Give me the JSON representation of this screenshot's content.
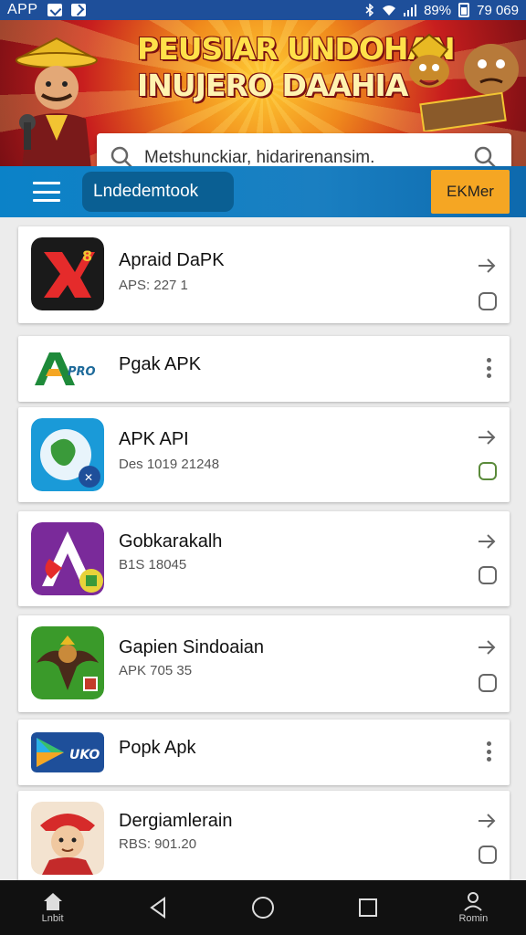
{
  "status_bar": {
    "app": "APP",
    "battery": "89%",
    "time": "79 069",
    "icons": [
      "image-icon",
      "download-icon",
      "bluetooth-icon",
      "wifi-icon",
      "signal-icon",
      "battery-icon"
    ]
  },
  "banner": {
    "title_line1": "PEUSIAR UNDOHAN",
    "title_line2": "INUJERO DAAHIA"
  },
  "search": {
    "value": "Metshunckiar, hidarirenansim."
  },
  "toolbar": {
    "title": "Lndedemtook",
    "enter_label": "EKMer"
  },
  "apps": [
    {
      "name": "Apraid DaPK",
      "sub": "APS: 227 1",
      "action": "arrow"
    },
    {
      "name": "Pgak APK",
      "sub": "",
      "action": "more",
      "icon_text": "PRO"
    },
    {
      "name": "APK API",
      "sub": "Des 1019 21248",
      "action": "arrow"
    },
    {
      "name": "Gobkarakalh",
      "sub": "B1S 18045",
      "action": "arrow"
    },
    {
      "name": "Gapien Sindoaian",
      "sub": "APK 705 35",
      "action": "arrow"
    },
    {
      "name": "Popk Apk",
      "sub": "",
      "action": "more",
      "icon_text": "UKO"
    },
    {
      "name": "Dergiamlerain",
      "sub": "RBS: 901.20",
      "action": "arrow"
    }
  ],
  "nav": {
    "home_label": "Lnbit",
    "profile_label": "Romin"
  },
  "colors": {
    "status_bar": "#1e4f9a",
    "toolbar": "#0b82c8",
    "enter_button": "#f5a623"
  }
}
